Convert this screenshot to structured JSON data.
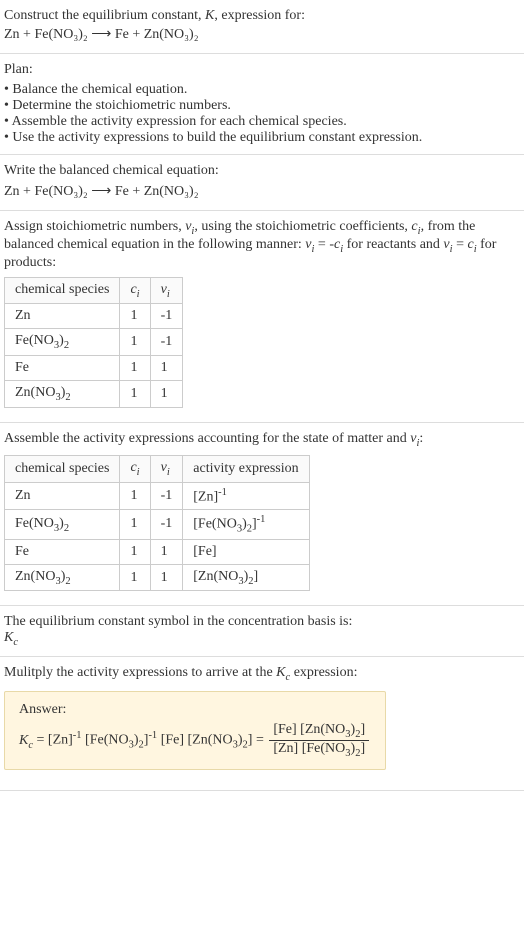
{
  "intro": {
    "line1": "Construct the equilibrium constant, K, expression for:",
    "equation": "Zn + Fe(NO₃)₂ ⟶ Fe + Zn(NO₃)₂"
  },
  "plan": {
    "heading": "Plan:",
    "items": [
      "• Balance the chemical equation.",
      "• Determine the stoichiometric numbers.",
      "• Assemble the activity expression for each chemical species.",
      "• Use the activity expressions to build the equilibrium constant expression."
    ]
  },
  "balanced": {
    "heading": "Write the balanced chemical equation:",
    "equation": "Zn + Fe(NO₃)₂ ⟶ Fe + Zn(NO₃)₂"
  },
  "stoich": {
    "text": "Assign stoichiometric numbers, νᵢ, using the stoichiometric coefficients, cᵢ, from the balanced chemical equation in the following manner: νᵢ = -cᵢ for reactants and νᵢ = cᵢ for products:",
    "headers": [
      "chemical species",
      "cᵢ",
      "νᵢ"
    ],
    "rows": [
      [
        "Zn",
        "1",
        "-1"
      ],
      [
        "Fe(NO₃)₂",
        "1",
        "-1"
      ],
      [
        "Fe",
        "1",
        "1"
      ],
      [
        "Zn(NO₃)₂",
        "1",
        "1"
      ]
    ]
  },
  "activity": {
    "heading": "Assemble the activity expressions accounting for the state of matter and νᵢ:",
    "headers": [
      "chemical species",
      "cᵢ",
      "νᵢ",
      "activity expression"
    ],
    "rows": [
      [
        "Zn",
        "1",
        "-1",
        "[Zn]⁻¹"
      ],
      [
        "Fe(NO₃)₂",
        "1",
        "-1",
        "[Fe(NO₃)₂]⁻¹"
      ],
      [
        "Fe",
        "1",
        "1",
        "[Fe]"
      ],
      [
        "Zn(NO₃)₂",
        "1",
        "1",
        "[Zn(NO₃)₂]"
      ]
    ]
  },
  "symbol": {
    "line1": "The equilibrium constant symbol in the concentration basis is:",
    "line2": "K_c"
  },
  "multiply": {
    "heading": "Mulitply the activity expressions to arrive at the K_c expression:"
  },
  "answer": {
    "label": "Answer:",
    "lhs": "K_c = [Zn]⁻¹ [Fe(NO₃)₂]⁻¹ [Fe] [Zn(NO₃)₂] = ",
    "num": "[Fe] [Zn(NO₃)₂]",
    "den": "[Zn] [Fe(NO₃)₂]"
  },
  "chart_data": {
    "type": "table",
    "tables": [
      {
        "headers": [
          "chemical species",
          "c_i",
          "ν_i"
        ],
        "rows": [
          [
            "Zn",
            1,
            -1
          ],
          [
            "Fe(NO3)2",
            1,
            -1
          ],
          [
            "Fe",
            1,
            1
          ],
          [
            "Zn(NO3)2",
            1,
            1
          ]
        ]
      },
      {
        "headers": [
          "chemical species",
          "c_i",
          "ν_i",
          "activity expression"
        ],
        "rows": [
          [
            "Zn",
            1,
            -1,
            "[Zn]^-1"
          ],
          [
            "Fe(NO3)2",
            1,
            -1,
            "[Fe(NO3)2]^-1"
          ],
          [
            "Fe",
            1,
            1,
            "[Fe]"
          ],
          [
            "Zn(NO3)2",
            1,
            1,
            "[Zn(NO3)2]"
          ]
        ]
      }
    ]
  }
}
